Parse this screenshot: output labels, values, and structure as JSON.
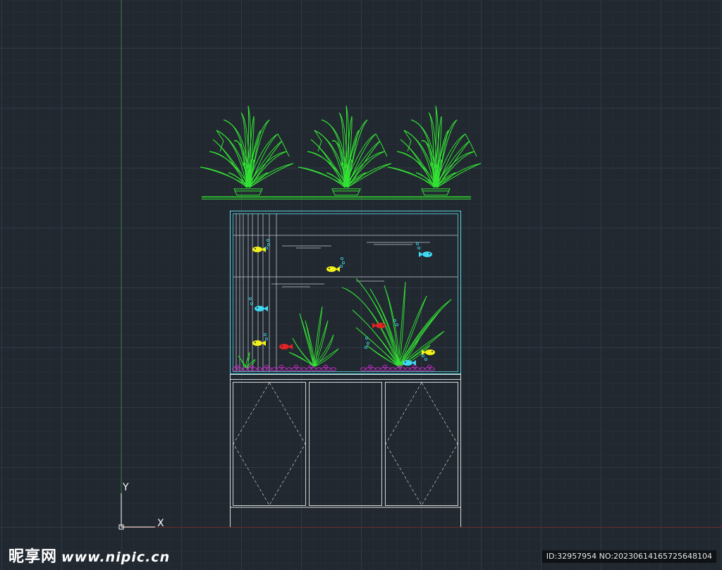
{
  "viewport": {
    "background_color": "#212830",
    "grid_major_color": "#2f3946",
    "grid_minor_color": "#262d37",
    "y_axis_color": "#2f7a3a",
    "x_axis_color": "#6e2a2a"
  },
  "ucs_icon": {
    "x_label": "X",
    "y_label": "Y",
    "color": "#ffffff"
  },
  "drawing": {
    "palette": {
      "plant_green": "#33e333",
      "tank_cyan": "#5ed4e0",
      "cabinet_white": "#e8e8e8",
      "fish_yellow": "#f2f21a",
      "fish_cyan": "#3fd9f0",
      "fish_red": "#e22424",
      "gravel_magenta": "#c02cc0",
      "water_lines": "#bfc6cc"
    },
    "pots": [
      "potted-plant-left",
      "potted-plant-center",
      "potted-plant-right"
    ],
    "cabinet_doors": 3
  },
  "watermark": {
    "logo_text": "昵享网",
    "site_text": "www.nipic.cn",
    "id_text": "ID:32957954 NO:20230614165725648104"
  }
}
